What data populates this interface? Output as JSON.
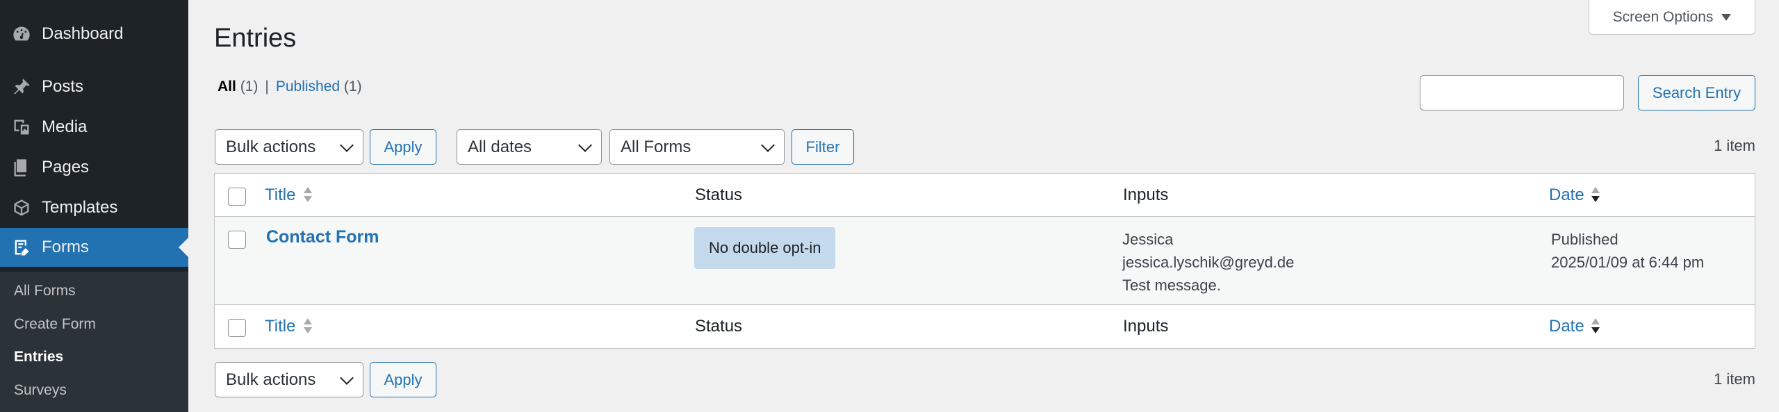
{
  "sidebar": {
    "items": [
      {
        "label": "Dashboard",
        "icon": "dashboard-icon"
      },
      {
        "label": "Posts",
        "icon": "pushpin-icon"
      },
      {
        "label": "Media",
        "icon": "media-icon"
      },
      {
        "label": "Pages",
        "icon": "pages-icon"
      },
      {
        "label": "Templates",
        "icon": "cube-icon"
      },
      {
        "label": "Forms",
        "icon": "forms-icon",
        "current": true
      }
    ],
    "submenu": [
      {
        "label": "All Forms"
      },
      {
        "label": "Create Form"
      },
      {
        "label": "Entries",
        "current": true
      },
      {
        "label": "Surveys"
      }
    ]
  },
  "screen_options": {
    "label": "Screen Options"
  },
  "page_title": "Entries",
  "views": {
    "all_label": "All",
    "all_count": "(1)",
    "separator": "|",
    "published_label": "Published",
    "published_count": "(1)"
  },
  "search": {
    "value": "",
    "button_label": "Search Entry"
  },
  "top_nav": {
    "bulk_actions": "Bulk actions",
    "apply_label": "Apply",
    "dates_filter": "All dates",
    "forms_filter": "All Forms",
    "filter_label": "Filter",
    "items_count": "1 item"
  },
  "table": {
    "columns": {
      "title": "Title",
      "status": "Status",
      "inputs": "Inputs",
      "date": "Date"
    },
    "rows": [
      {
        "title": "Contact Form",
        "status": "No double opt-in",
        "inputs": [
          "Jessica",
          "jessica.lyschik@greyd.de",
          "Test message."
        ],
        "date_status": "Published",
        "date": "2025/01/09 at 6:44 pm"
      }
    ]
  },
  "bottom_nav": {
    "bulk_actions": "Bulk actions",
    "apply_label": "Apply",
    "items_count": "1 item"
  },
  "colors": {
    "sidebar_bg": "#1d2327",
    "submenu_bg": "#2c3338",
    "accent": "#2271b1",
    "badge_bg": "#c5d9ed",
    "page_bg": "#f0f0f1"
  }
}
